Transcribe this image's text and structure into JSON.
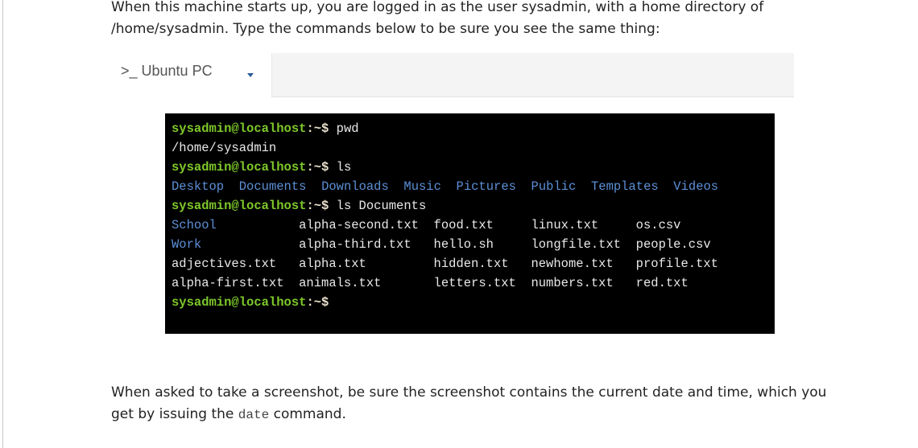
{
  "intro": "When this machine starts up, you are logged in as the user sysadmin, with a home directory of /home/sysadmin. Type the commands below to be sure you see the same thing:",
  "tab": {
    "label": ">_ Ubuntu PC",
    "icon": "caret-down-icon"
  },
  "terminal": {
    "prompt_user": "sysadmin@localhost",
    "prompt_suffix": ":~$",
    "cmd1": " pwd",
    "out1": "/home/sysadmin",
    "cmd2": " ls",
    "ls_home": [
      "Desktop",
      "Documents",
      "Downloads",
      "Music",
      "Pictures",
      "Public",
      "Templates",
      "Videos"
    ],
    "cmd3": " ls Documents",
    "ls_docs": [
      [
        "School",
        "alpha-second.txt",
        "food.txt",
        "linux.txt",
        "os.csv"
      ],
      [
        "Work",
        "alpha-third.txt",
        "hello.sh",
        "longfile.txt",
        "people.csv"
      ],
      [
        "adjectives.txt",
        "alpha.txt",
        "hidden.txt",
        "newhome.txt",
        "profile.txt"
      ],
      [
        "alpha-first.txt",
        "animals.txt",
        "letters.txt",
        "numbers.txt",
        "red.txt"
      ]
    ],
    "directory_color": "#5c8fd6",
    "prompt_color": "#7ec82a"
  },
  "outro": {
    "before": "When asked to take a screenshot, be sure the screenshot contains the current date and time, which you get by issuing the ",
    "code": "date",
    "after": " command."
  }
}
